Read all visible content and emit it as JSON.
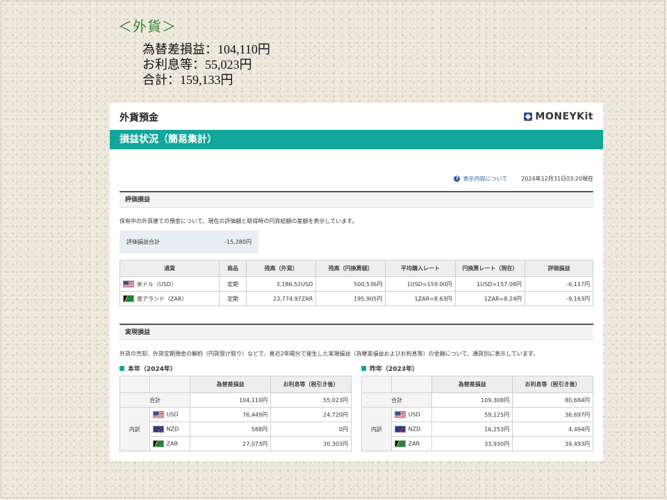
{
  "slide": {
    "heading": "＜外貨＞",
    "summary": [
      "為替差損益：104,110円",
      "お利息等：55,023円",
      "合計：159,133円"
    ]
  },
  "panel": {
    "title": "外貨預金",
    "logo": "MONEYKit",
    "banner": "損益状況（簡易集計）",
    "help_link": "表示内容について",
    "as_of": "2024年12月31日03:20現在"
  },
  "valuation": {
    "header": "評価損益",
    "description": "保有中の外貨建ての預金について、現在の評価額と取得時の円貨総額の差額を表示しています。",
    "total_label": "評価損益合計",
    "total_value": "-15,280円",
    "columns": [
      "通貨",
      "商品",
      "残高（外貨）",
      "残高（円換算額）",
      "平均購入レート",
      "円換算レート（現在）",
      "評価損益"
    ],
    "rows": [
      {
        "flag": "us",
        "currency": "米ドル（USD）",
        "product": "定期",
        "bal_fx": "3,186.52USD",
        "bal_jpy": "500,536円",
        "avg_rate": "1USD=159.00円",
        "cur_rate": "1USD=157.08円",
        "pl": "-6,117円"
      },
      {
        "flag": "za",
        "currency": "南アランド（ZAR）",
        "product": "定期",
        "bal_fx": "23,774.97ZAR",
        "bal_jpy": "195,905円",
        "avg_rate": "1ZAR=8.63円",
        "cur_rate": "1ZAR=8.24円",
        "pl": "-9,163円"
      }
    ]
  },
  "realized": {
    "header": "実現損益",
    "description": "外貨の売却、外貨定期預金の解約（円貨受け取り）などで、直近2年間分で発生した実現損益（為替差損益およびお利息等）の金額について、通貨別に表示しています。",
    "col_fx": "為替差損益",
    "col_interest": "お利息等（税引き後）",
    "total_label": "合計",
    "breakdown_label": "内訳",
    "this_year": {
      "title": "本年（2024年）",
      "total_fx": "104,110円",
      "total_interest": "55,023円",
      "rows": [
        {
          "flag": "us",
          "code": "USD",
          "fx": "76,449円",
          "interest": "24,720円"
        },
        {
          "flag": "nz",
          "code": "NZD",
          "fx": "588円",
          "interest": "0円"
        },
        {
          "flag": "za",
          "code": "ZAR",
          "fx": "27,073円",
          "interest": "30,303円"
        }
      ]
    },
    "last_year": {
      "title": "昨年（2023年）",
      "total_fx": "109,308円",
      "total_interest": "80,684円",
      "rows": [
        {
          "flag": "us",
          "code": "USD",
          "fx": "59,125円",
          "interest": "36,697円"
        },
        {
          "flag": "nz",
          "code": "NZD",
          "fx": "16,253円",
          "interest": "4,494円"
        },
        {
          "flag": "za",
          "code": "ZAR",
          "fx": "33,930円",
          "interest": "39,493円"
        }
      ]
    }
  }
}
